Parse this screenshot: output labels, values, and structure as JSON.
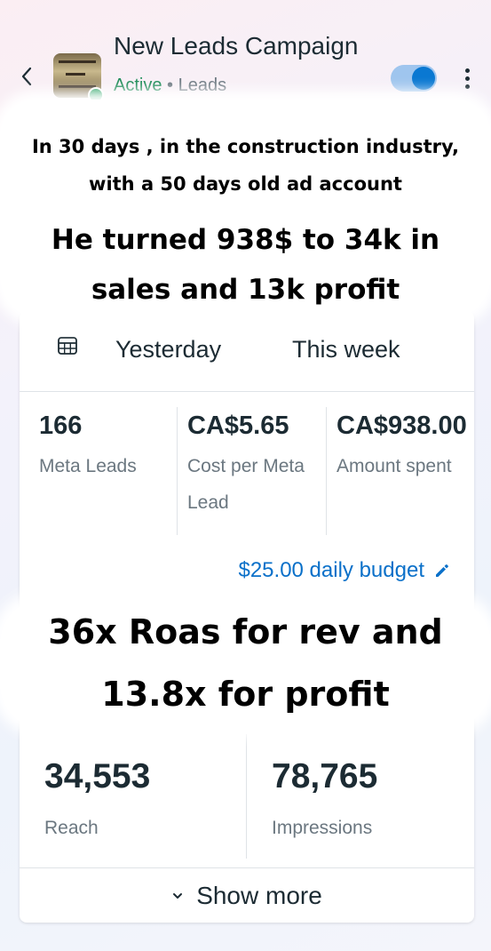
{
  "header": {
    "campaign_name": "New Leads Campaign",
    "status": "Active",
    "separator": "•",
    "objective": "Leads",
    "toggle_on": true,
    "back_icon": "chevron-left-icon",
    "more_icon": "more-vertical-icon"
  },
  "overlay": {
    "caption_1": "In 30 days , in the construction industry, with a 50 days old ad account",
    "caption_2": "He turned 938$ to 34k in sales and 13k profit",
    "caption_3": "36x Roas for rev and 13.8x for profit"
  },
  "date_tabs": {
    "calendar_icon": "calendar-icon",
    "yesterday": "Yesterday",
    "this_week": "This week"
  },
  "metrics": [
    {
      "value": "166",
      "label": "Meta Leads"
    },
    {
      "value": "CA$5.65",
      "label": "Cost per Meta Lead"
    },
    {
      "value": "CA$938.00",
      "label": "Amount spent"
    }
  ],
  "budget": {
    "label": "$25.00 daily budget",
    "edit_icon": "pencil-icon"
  },
  "reach": {
    "value": "34,553",
    "label": "Reach"
  },
  "impressions": {
    "value": "78,765",
    "label": "Impressions"
  },
  "show_more": {
    "label": "Show more",
    "icon": "chevron-down-icon"
  },
  "colors": {
    "accent": "#0a78d2",
    "active_green": "#1a8a55",
    "text_primary": "#1c2b33",
    "text_secondary": "#6b7780"
  }
}
